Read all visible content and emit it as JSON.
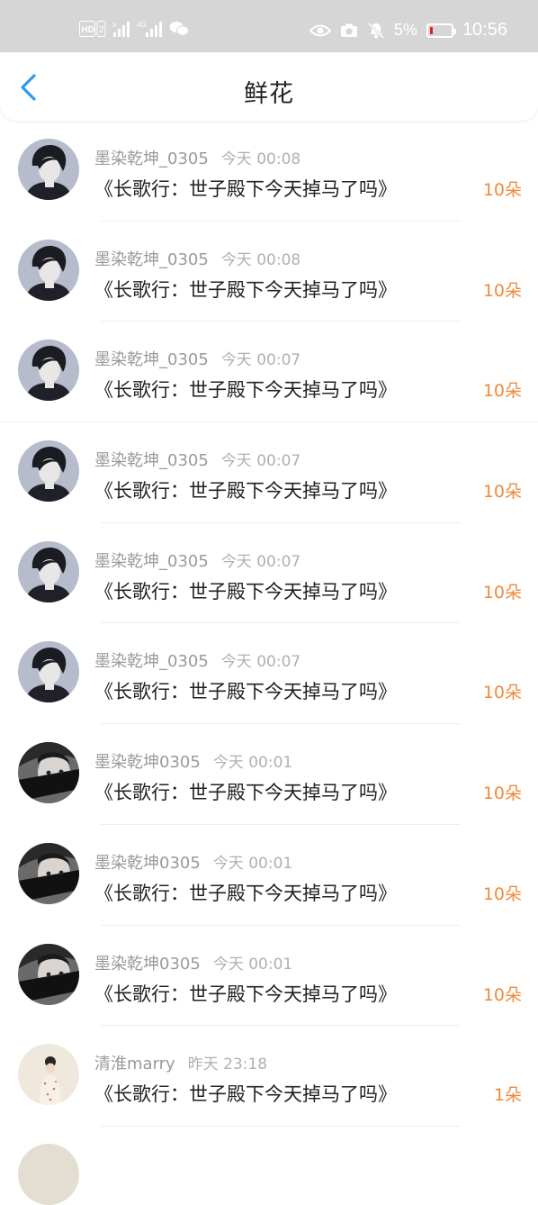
{
  "status_bar": {
    "left_icons": [
      "hd-icon",
      "signal-icon",
      "4g-signal-icon",
      "wechat-icon"
    ],
    "right_icons": [
      "eye-icon",
      "camera-icon",
      "mute-bell-icon"
    ],
    "battery_percent": "5%",
    "time": "10:56"
  },
  "header": {
    "title": "鲜花",
    "back_icon": "chevron-left-icon"
  },
  "colors": {
    "status_bar_bg": "#d6d6d6",
    "accent_back": "#2f9ae8",
    "flower_count": "#f08a3a",
    "battery_low": "#e0262a"
  },
  "items": [
    {
      "avatar": "avatar-a",
      "username": "墨染乾坤_0305",
      "time": "今天 00:08",
      "book": "《长歌行：世子殿下今天掉马了吗》",
      "count": "10朵"
    },
    {
      "avatar": "avatar-a",
      "username": "墨染乾坤_0305",
      "time": "今天 00:08",
      "book": "《长歌行：世子殿下今天掉马了吗》",
      "count": "10朵"
    },
    {
      "avatar": "avatar-a",
      "username": "墨染乾坤_0305",
      "time": "今天 00:07",
      "book": "《长歌行：世子殿下今天掉马了吗》",
      "count": "10朵"
    },
    {
      "avatar": "avatar-a",
      "username": "墨染乾坤_0305",
      "time": "今天 00:07",
      "book": "《长歌行：世子殿下今天掉马了吗》",
      "count": "10朵"
    },
    {
      "avatar": "avatar-a",
      "username": "墨染乾坤_0305",
      "time": "今天 00:07",
      "book": "《长歌行：世子殿下今天掉马了吗》",
      "count": "10朵"
    },
    {
      "avatar": "avatar-a",
      "username": "墨染乾坤_0305",
      "time": "今天 00:07",
      "book": "《长歌行：世子殿下今天掉马了吗》",
      "count": "10朵"
    },
    {
      "avatar": "avatar-b",
      "username": "墨染乾坤0305",
      "time": "今天 00:01",
      "book": "《长歌行：世子殿下今天掉马了吗》",
      "count": "10朵"
    },
    {
      "avatar": "avatar-b",
      "username": "墨染乾坤0305",
      "time": "今天 00:01",
      "book": "《长歌行：世子殿下今天掉马了吗》",
      "count": "10朵"
    },
    {
      "avatar": "avatar-b",
      "username": "墨染乾坤0305",
      "time": "今天 00:01",
      "book": "《长歌行：世子殿下今天掉马了吗》",
      "count": "10朵"
    },
    {
      "avatar": "avatar-c",
      "username": "清淮marry",
      "time": "昨天 23:18",
      "book": "《长歌行：世子殿下今天掉马了吗》",
      "count": "1朵"
    }
  ]
}
